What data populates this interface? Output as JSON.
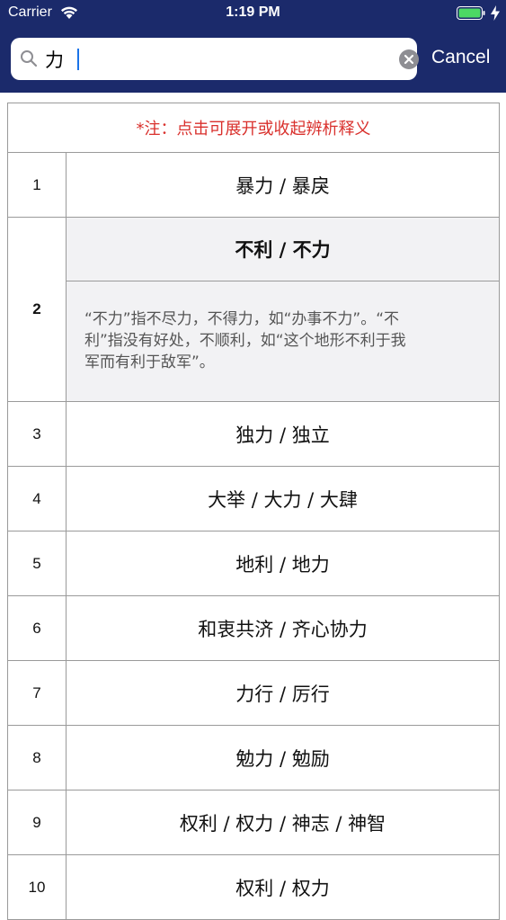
{
  "status_bar": {
    "carrier": "Carrier",
    "time": "1:19 PM"
  },
  "search": {
    "query": "力",
    "cancel_label": "Cancel"
  },
  "note": "*注：点击可展开或收起辨析释义",
  "colors": {
    "header": "#1b2a6b",
    "note": "#d9302c",
    "expanded_bg": "#f2f2f4"
  },
  "rows": [
    {
      "num": "1",
      "words": "暴力 / 暴戾"
    },
    {
      "num": "2",
      "words": "不利 / 不力",
      "desc": "“不力”指不尽力，不得力，如“办事不力”。“不利”指没有好处，不顺利，如“这个地形不利于我军而有利于敌军”。"
    },
    {
      "num": "3",
      "words": "独力 / 独立"
    },
    {
      "num": "4",
      "words": "大举 / 大力 / 大肆"
    },
    {
      "num": "5",
      "words": "地利 / 地力"
    },
    {
      "num": "6",
      "words": "和衷共济 / 齐心协力"
    },
    {
      "num": "7",
      "words": "力行 / 厉行"
    },
    {
      "num": "8",
      "words": "勉力 / 勉励"
    },
    {
      "num": "9",
      "words": "权利 / 权力 / 神志 / 神智"
    },
    {
      "num": "10",
      "words": "权利 / 权力"
    }
  ]
}
